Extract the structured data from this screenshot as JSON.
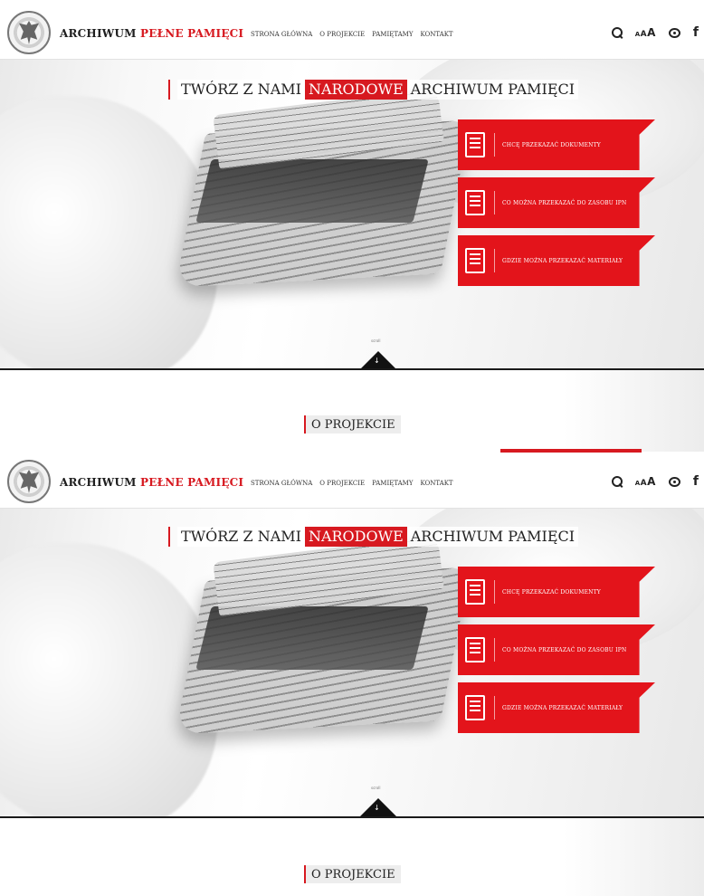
{
  "site": {
    "logo_prefix": "ARCHIWUM ",
    "logo_accent": "PEŁNE PAMIĘCI",
    "nav": [
      "STRONA GŁÓWNA",
      "O PROJEKCIE",
      "PAMIĘTAMY",
      "KONTAKT"
    ],
    "font_sizes": [
      "A",
      "A",
      "A"
    ],
    "facebook": "f"
  },
  "hero": {
    "headline_1": "TWÓRZ Z NAMI",
    "headline_2": "NARODOWE",
    "headline_3": "ARCHIWUM PAMIĘCI",
    "actions": [
      {
        "label": "CHCĘ PRZEKAZAĆ DOKUMENTY",
        "icon": "document-download-icon"
      },
      {
        "label": "CO MOŻNA PRZEKAZAĆ DO ZASOBU IPN",
        "icon": "document-list-icon"
      },
      {
        "label": "GDZIE MOŻNA PRZEKAZAĆ MATERIAŁY",
        "icon": "document-search-icon"
      }
    ],
    "scroll_hint": "scroll",
    "scroll_arrow": "↓"
  },
  "section": {
    "title": "O PROJEKCIE"
  },
  "colors": {
    "accent": "#d71920",
    "dark": "#111111"
  }
}
